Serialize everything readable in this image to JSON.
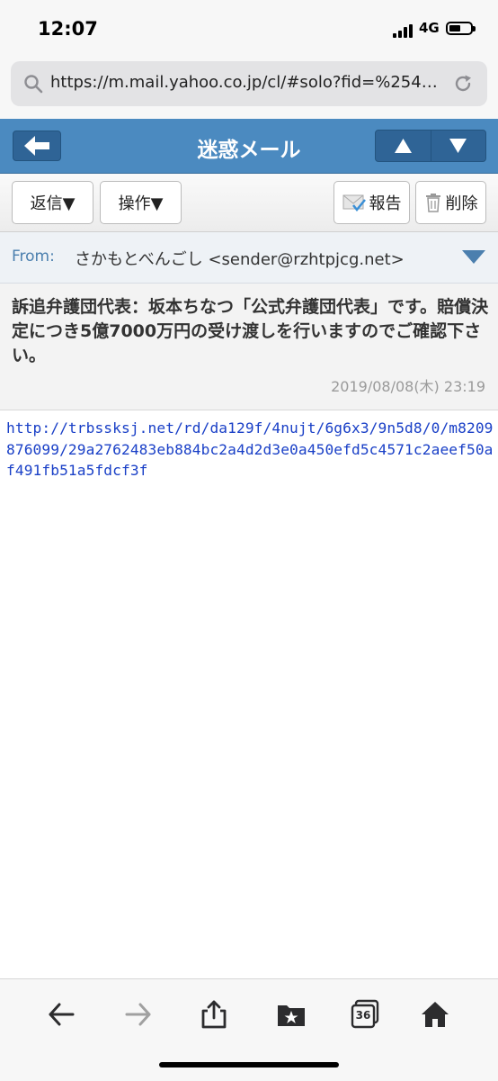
{
  "status_bar": {
    "time": "12:07",
    "network": "4G"
  },
  "browser": {
    "url": "https://m.mail.yahoo.co.jp/cl/#solo?fid=%254…",
    "search_icon": "magnifier-icon",
    "reload_icon": "reload-icon"
  },
  "header": {
    "title": "迷惑メール",
    "back_icon": "arrow-left-icon",
    "prev_icon": "triangle-up-icon",
    "next_icon": "triangle-down-icon",
    "color": "#4b8ac0"
  },
  "toolbar": {
    "reply_label": "返信▼",
    "action_label": "操作▼",
    "report_label": "報告",
    "delete_label": "削除"
  },
  "message": {
    "from_label": "From:",
    "from_value": "さかもとべんごし <sender@rzhtpjcg.net>",
    "subject": "訴追弁護団代表：坂本ちなつ「公式弁護団代表」です。賠償決定につき5億7000万円の受け渡しを行いますのでご確認下さい。",
    "date": "2019/08/08(木) 23:19",
    "body_link": "http://trbssksj.net/rd/da129f/4nujt/6g6x3/9n5d8/0/m8209876099/29a2762483eb884bc2a4d2d3e0a450efd5c4571c2aeef50af491fb51a5fdcf3f"
  },
  "bottom_bar": {
    "tabs_count": "36",
    "icons": [
      "back-arrow-icon",
      "forward-arrow-icon",
      "share-icon",
      "bookmarks-icon",
      "tabs-icon",
      "home-icon"
    ]
  }
}
